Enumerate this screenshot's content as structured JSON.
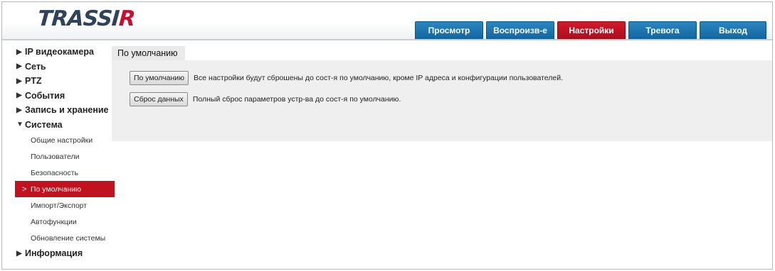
{
  "header": {
    "logo_main": "TRASSI",
    "logo_accent": "R",
    "nav": [
      {
        "label": "Просмотр",
        "active": false
      },
      {
        "label": "Воспроизв-е",
        "active": false
      },
      {
        "label": "Настройки",
        "active": true
      },
      {
        "label": "Тревога",
        "active": false
      },
      {
        "label": "Выход",
        "active": false
      }
    ]
  },
  "sidebar": {
    "sections": [
      {
        "label": "IP видеокамера",
        "arrow": "▶",
        "expanded": false
      },
      {
        "label": "Сеть",
        "arrow": "▶",
        "expanded": false
      },
      {
        "label": "PTZ",
        "arrow": "▶",
        "expanded": false
      },
      {
        "label": "События",
        "arrow": "▶",
        "expanded": false
      },
      {
        "label": "Запись и хранение",
        "arrow": "▶",
        "expanded": false
      },
      {
        "label": "Система",
        "arrow": "▼",
        "expanded": true
      },
      {
        "label": "Информация",
        "arrow": "▶",
        "expanded": false
      }
    ],
    "system_items": [
      {
        "label": "Общие настройки",
        "active": false
      },
      {
        "label": "Пользователи",
        "active": false
      },
      {
        "label": "Безопасность",
        "active": false
      },
      {
        "label": "По умолчанию",
        "active": true,
        "chevron": ">"
      },
      {
        "label": "Импорт/Экспорт",
        "active": false
      },
      {
        "label": "Автофункции",
        "active": false
      },
      {
        "label": "Обновление системы",
        "active": false
      }
    ]
  },
  "content": {
    "tab_label": "По умолчанию",
    "rows": [
      {
        "button": "По умолчанию",
        "description": "Все настройки будут сброшены до сост-я по умолчанию, кроме IP адреса и конфигурации пользователей."
      },
      {
        "button": "Сброс данных",
        "description": "Полный сброс параметров устр-ва до сост-я по умолчанию."
      }
    ]
  },
  "colors": {
    "nav_blue": "#1a72ad",
    "accent_red": "#c0131f",
    "logo_dark": "#30435a"
  }
}
